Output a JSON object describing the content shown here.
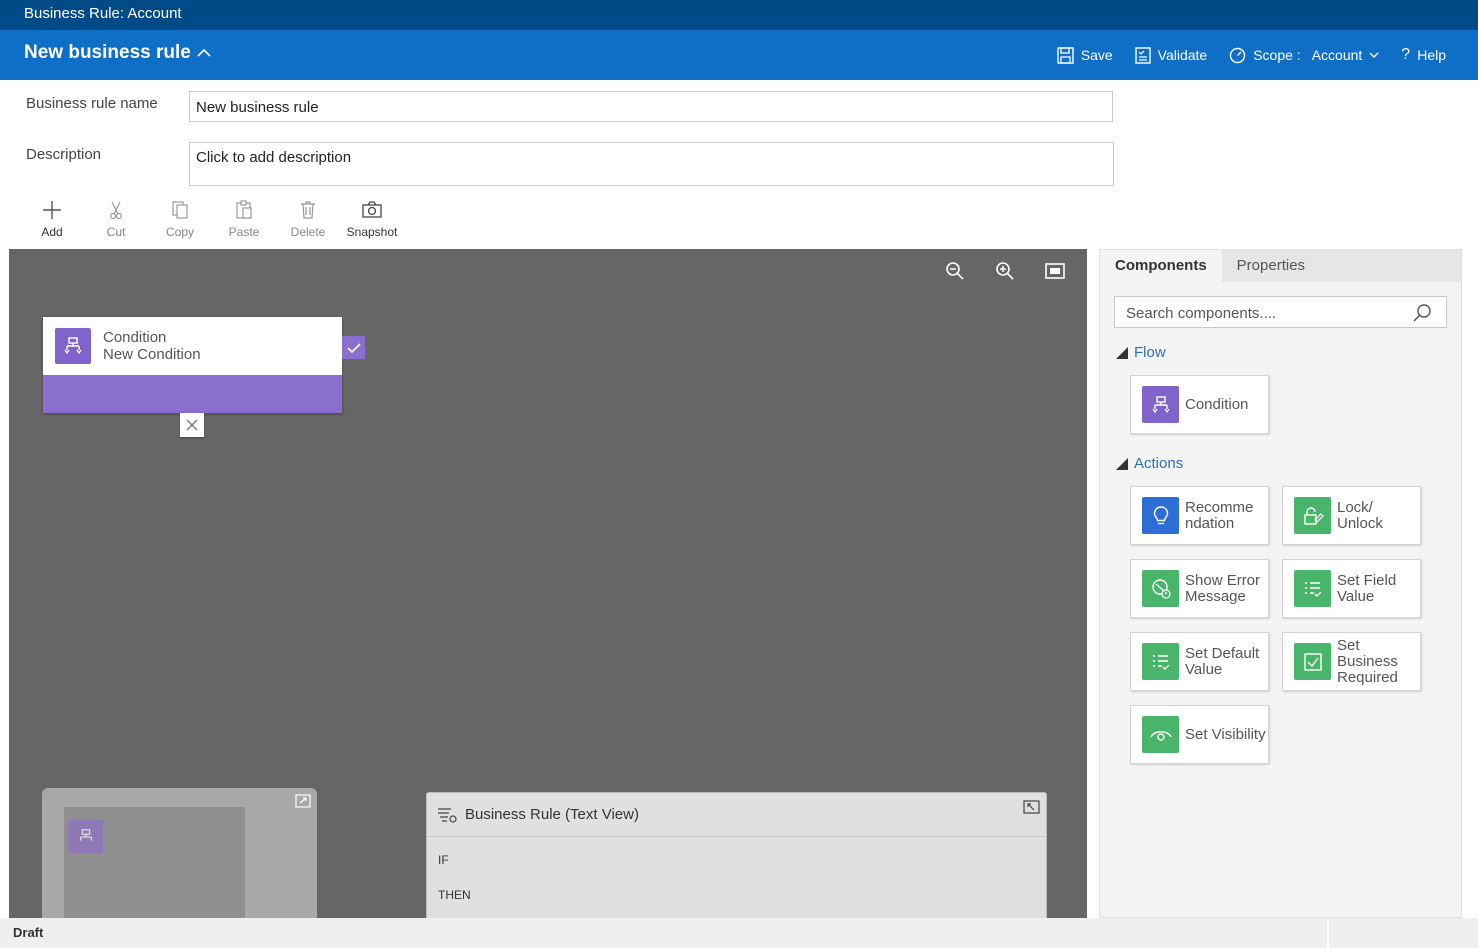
{
  "window": {
    "title": "Business Rule: Account"
  },
  "header": {
    "rule_title": "New business rule",
    "save_label": "Save",
    "validate_label": "Validate",
    "scope_label": "Scope :",
    "scope_value": "Account",
    "help_label": "Help"
  },
  "form": {
    "name_label": "Business rule name",
    "name_value": "New business rule",
    "description_label": "Description",
    "description_value": "Click to add description"
  },
  "toolbar": {
    "add": "Add",
    "cut": "Cut",
    "copy": "Copy",
    "paste": "Paste",
    "delete": "Delete",
    "snapshot": "Snapshot"
  },
  "canvas": {
    "condition_card": {
      "type": "Condition",
      "name": "New Condition"
    }
  },
  "text_view": {
    "title": "Business Rule (Text View)",
    "if_label": "IF",
    "then_label": "THEN"
  },
  "panel": {
    "tabs": [
      "Components",
      "Properties"
    ],
    "active_tab": "Components",
    "search_placeholder": "Search components....",
    "flow_title": "Flow",
    "actions_title": "Actions",
    "flow_items": [
      {
        "label": "Condition",
        "icon": "condition-icon",
        "color": "#8064c9"
      }
    ],
    "action_items": [
      {
        "label": "Recomme ndation",
        "icon": "lightbulb-icon",
        "color": "#2c6ed6"
      },
      {
        "label": "Lock/ Unlock",
        "icon": "lock-unlock-icon",
        "color": "#49b56a"
      },
      {
        "label": "Show Error Message",
        "icon": "error-message-icon",
        "color": "#49b56a"
      },
      {
        "label": "Set Field Value",
        "icon": "set-field-value-icon",
        "color": "#49b56a"
      },
      {
        "label": "Set Default Value",
        "icon": "set-default-value-icon",
        "color": "#49b56a"
      },
      {
        "label": "Set Business Required",
        "icon": "business-required-icon",
        "color": "#49b56a"
      },
      {
        "label": "Set Visibility",
        "icon": "visibility-icon",
        "color": "#49b56a"
      }
    ]
  },
  "status": {
    "state": "Draft"
  }
}
